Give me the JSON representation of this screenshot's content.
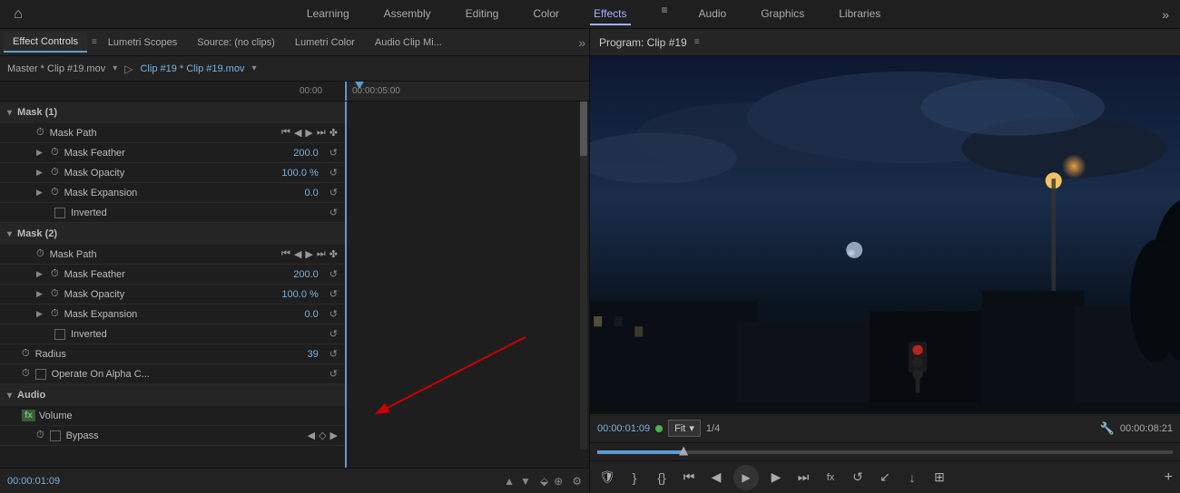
{
  "topNav": {
    "items": [
      "Learning",
      "Assembly",
      "Editing",
      "Color",
      "Effects",
      "Audio",
      "Graphics",
      "Libraries"
    ],
    "activeItem": "Effects",
    "homeIcon": "⌂"
  },
  "leftPanel": {
    "tabs": [
      {
        "label": "Effect Controls",
        "active": true
      },
      {
        "label": "Lumetri Scopes",
        "active": false
      },
      {
        "label": "Source: (no clips)",
        "active": false
      },
      {
        "label": "Lumetri Color",
        "active": false
      },
      {
        "label": "Audio Clip Mi...",
        "active": false
      }
    ],
    "clipBar": {
      "masterLabel": "Master * Clip #19.mov",
      "clipLabel": "Clip #19 * Clip #19.mov"
    },
    "timeStart": "00:00",
    "timeMid": "00:00:05:00",
    "mask1": {
      "label": "Mask (1)",
      "maskPath": "Mask Path",
      "maskFeather": {
        "label": "Mask Feather",
        "value": "200.0"
      },
      "maskOpacity": {
        "label": "Mask Opacity",
        "value": "100.0 %"
      },
      "maskExpansion": {
        "label": "Mask Expansion",
        "value": "0.0"
      },
      "inverted": "Inverted"
    },
    "mask2": {
      "label": "Mask (2)",
      "maskPath": "Mask Path",
      "maskFeather": {
        "label": "Mask Feather",
        "value": "200.0"
      },
      "maskOpacity": {
        "label": "Mask Opacity",
        "value": "100.0 %"
      },
      "maskExpansion": {
        "label": "Mask Expansion",
        "value": "0.0"
      },
      "inverted": "Inverted"
    },
    "radius": {
      "label": "Radius",
      "value": "39"
    },
    "operateAlpha": {
      "label": "Operate On Alpha C..."
    },
    "audio": {
      "label": "Audio",
      "fx": "fx",
      "volume": {
        "label": "Volume"
      },
      "bypass": {
        "label": "Bypass"
      }
    },
    "bottomTimecode": "00:00:01:09"
  },
  "rightPanel": {
    "title": "Program: Clip #19",
    "menuIcon": "≡",
    "monitorTimecode": "00:00:01:09",
    "fitOption": "Fit",
    "fraction": "1/4",
    "endTimecode": "00:00:08:21"
  }
}
